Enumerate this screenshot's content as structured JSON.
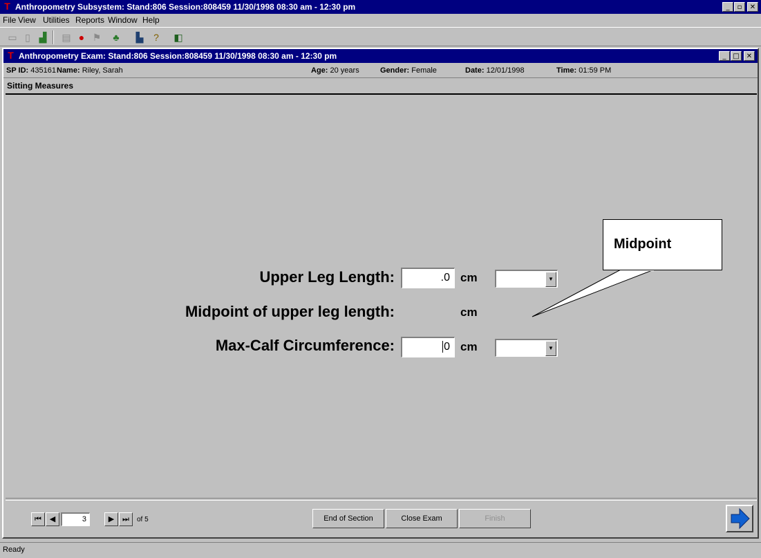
{
  "app": {
    "title": "Anthropometry Subsystem: Stand:806 Session:808459 11/30/1998 08:30 am - 12:30 pm",
    "menu": [
      "File",
      "View",
      "Utilities",
      "Reports",
      "Window",
      "Help"
    ]
  },
  "window": {
    "title": "Anthropometry Exam: Stand:806 Session:808459 11/30/1998 08:30 am - 12:30 pm"
  },
  "info": {
    "sp_id_label": "SP ID:",
    "sp_id": "435161",
    "name_label": "Name:",
    "name": "Riley, Sarah",
    "age_label": "Age:",
    "age": "20 years",
    "gender_label": "Gender:",
    "gender": "Female",
    "date_label": "Date:",
    "date": "12/01/1998",
    "time_label": "Time:",
    "time": "01:59 PM"
  },
  "section": {
    "title": "Sitting Measures"
  },
  "fields": {
    "upper_leg_label": "Upper Leg Length:",
    "upper_leg_value": ".0",
    "upper_leg_unit": "cm",
    "midpoint_label": "Midpoint of upper leg length:",
    "midpoint_unit": "cm",
    "calf_label": "Max-Calf Circumference:",
    "calf_value": "0",
    "calf_unit": "cm"
  },
  "callout": {
    "text": "Midpoint"
  },
  "nav": {
    "page": "3",
    "of": "of 5"
  },
  "buttons": {
    "end_section": "End of Section",
    "close_exam": "Close Exam",
    "finish": "Finish"
  },
  "status": {
    "text": "Ready"
  },
  "colors": {
    "titlebar": "#000080",
    "face": "#c0c0c0",
    "next_arrow": "#1060d0"
  }
}
